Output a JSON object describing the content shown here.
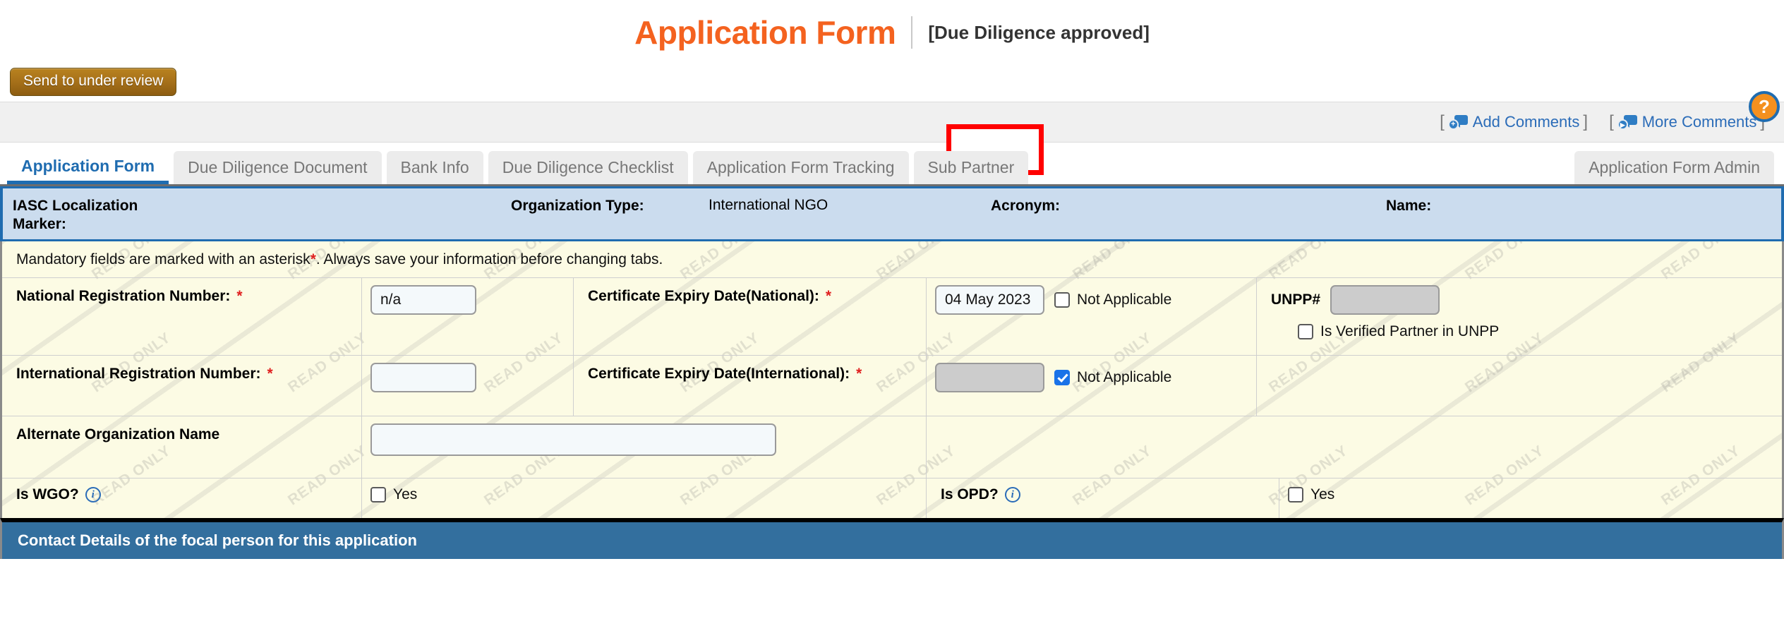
{
  "header": {
    "title": "Application Form",
    "status": "[Due Diligence approved]"
  },
  "toolbar": {
    "send_review_label": "Send to under review"
  },
  "comments_bar": {
    "bracket_open": "[",
    "bracket_close": "]",
    "add_comments_label": "Add Comments",
    "more_comments_label": "More Comments",
    "add_icon_badge": "+",
    "more_icon_badge": "▶",
    "help_label": "?"
  },
  "tabs": [
    {
      "label": "Application Form",
      "active": true
    },
    {
      "label": "Due Diligence Document",
      "active": false
    },
    {
      "label": "Bank Info",
      "active": false
    },
    {
      "label": "Due Diligence Checklist",
      "active": false
    },
    {
      "label": "Application Form Tracking",
      "active": false
    },
    {
      "label": "Sub Partner",
      "active": false,
      "highlighted": true
    }
  ],
  "tab_right": {
    "label": "Application Form Admin"
  },
  "org_band": {
    "iasc_label": "IASC Localization\nMarker:",
    "iasc_value": "",
    "org_type_label": "Organization Type:",
    "org_type_value": "International NGO",
    "acronym_label": "Acronym:",
    "acronym_value": "",
    "name_label": "Name:",
    "name_value": ""
  },
  "form": {
    "note_prefix": "Mandatory fields are marked with an asterisk ",
    "note_asterisk": "*",
    "note_suffix": ". Always save your information before changing tabs.",
    "watermark_text": "READ ONLY",
    "asterisk": "*",
    "rows": {
      "national_reg": {
        "label": "National Registration Number:",
        "value": "n/a",
        "placeholder": ""
      },
      "cert_expiry_national": {
        "label": "Certificate Expiry Date(National):",
        "value": "04 May 2023",
        "not_applicable_label": "Not Applicable",
        "not_applicable_checked": false
      },
      "unpp": {
        "label": "UNPP#",
        "value": "",
        "verified_label": "Is Verified Partner in UNPP",
        "verified_checked": false
      },
      "international_reg": {
        "label": "International Registration Number:",
        "value": "",
        "placeholder": ""
      },
      "cert_expiry_international": {
        "label": "Certificate Expiry Date(International):",
        "value": "",
        "not_applicable_label": "Not Applicable",
        "not_applicable_checked": true
      },
      "alternate_org_name": {
        "label": "Alternate Organization Name",
        "value": "",
        "placeholder": ""
      },
      "is_wgo": {
        "label": "Is WGO?",
        "yes_label": "Yes",
        "yes_checked": false,
        "info_glyph": "i"
      },
      "is_opd": {
        "label": "Is OPD?",
        "yes_label": "Yes",
        "yes_checked": false,
        "info_glyph": "i"
      }
    }
  },
  "section_header": {
    "contact_details": "Contact Details of the focal person for this application"
  },
  "colors": {
    "title_orange": "#f4621f",
    "accent_blue": "#1f6cb0",
    "checkbox_blue": "#1a73e8",
    "band_blue": "#cbdcee",
    "section_blue": "#336f9e",
    "highlight_red": "#ff0000",
    "form_cream": "#fcfbe4",
    "button_brown": "#a8721a"
  }
}
